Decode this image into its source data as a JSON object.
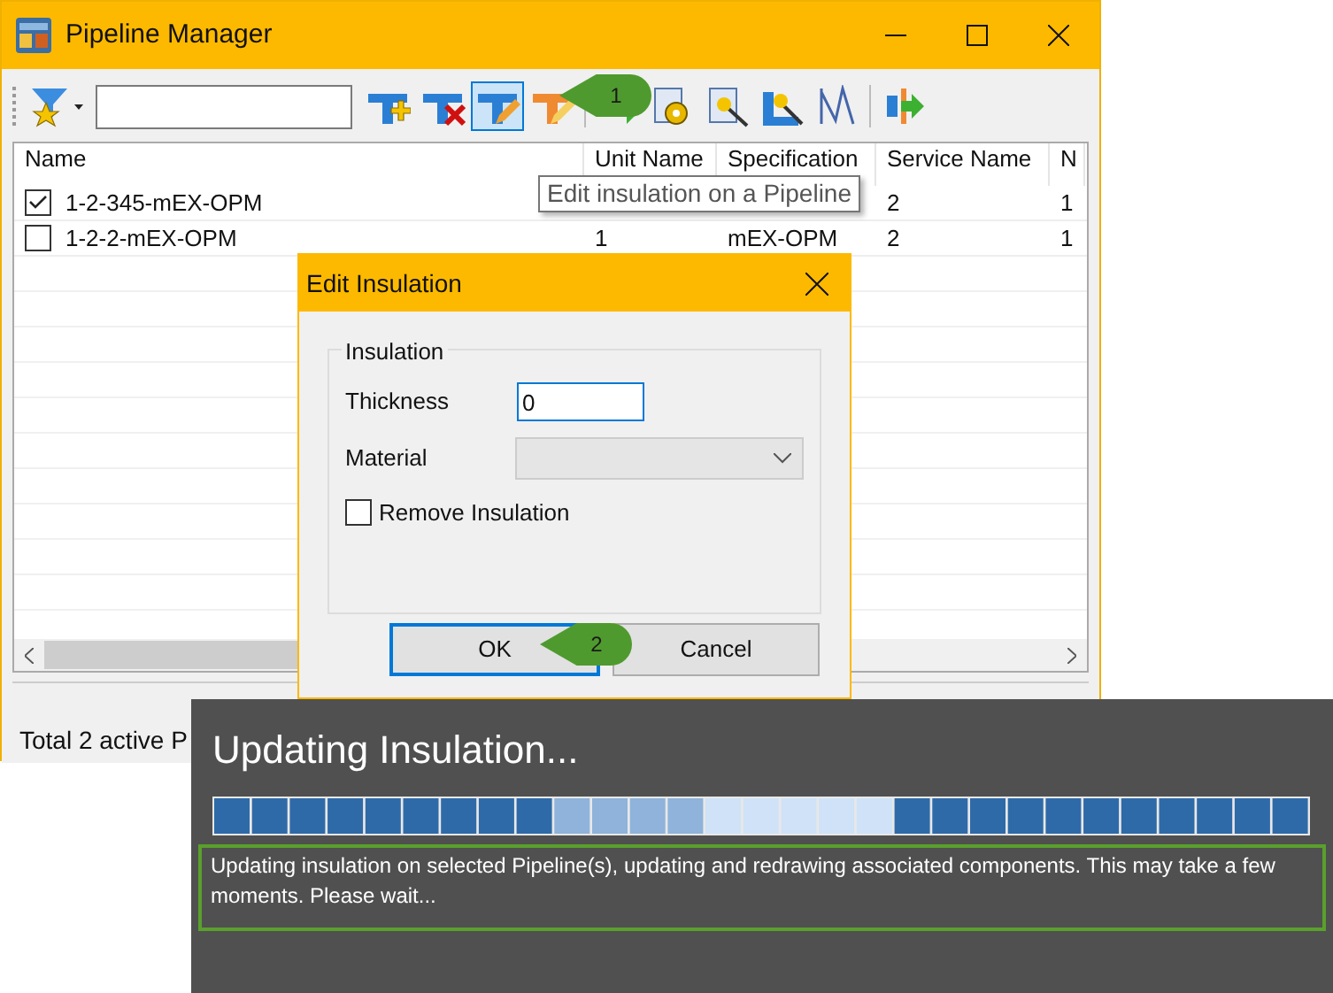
{
  "window": {
    "title": "Pipeline Manager"
  },
  "toolbar": {
    "tools": [
      {
        "selected": false
      },
      {
        "selected": false
      },
      {
        "selected": false
      },
      {
        "selected": true
      },
      {
        "selected": false
      },
      {
        "selected": false
      },
      {
        "selected": false
      },
      {
        "selected": false
      },
      {
        "selected": false
      },
      {
        "selected": false
      },
      {
        "selected": false
      }
    ]
  },
  "tooltip": "Edit insulation on a Pipeline",
  "table": {
    "columns": [
      "Name",
      "Unit Name",
      "Specification",
      "Service Name",
      "N"
    ],
    "rows": [
      {
        "checked": true,
        "cells": [
          "1-2-345-mEX-OPM",
          null,
          null,
          "2",
          "1"
        ]
      },
      {
        "checked": false,
        "cells": [
          "1-2-2-mEX-OPM",
          "1",
          "mEX-OPM",
          "2",
          "1"
        ]
      }
    ]
  },
  "status_bar": "Total 2 active P",
  "dialog": {
    "title": "Edit Insulation",
    "group": "Insulation",
    "thickness_label": "Thickness",
    "thickness_value": "0",
    "material_label": "Material",
    "remove_label": "Remove Insulation",
    "remove_checked": false,
    "ok": "OK",
    "cancel": "Cancel"
  },
  "callouts": [
    "1",
    "2"
  ],
  "progress": {
    "title": "Updating Insulation...",
    "message": "Updating insulation on selected Pipeline(s), updating and redrawing associated components. This may take a few moments. Please wait..."
  }
}
